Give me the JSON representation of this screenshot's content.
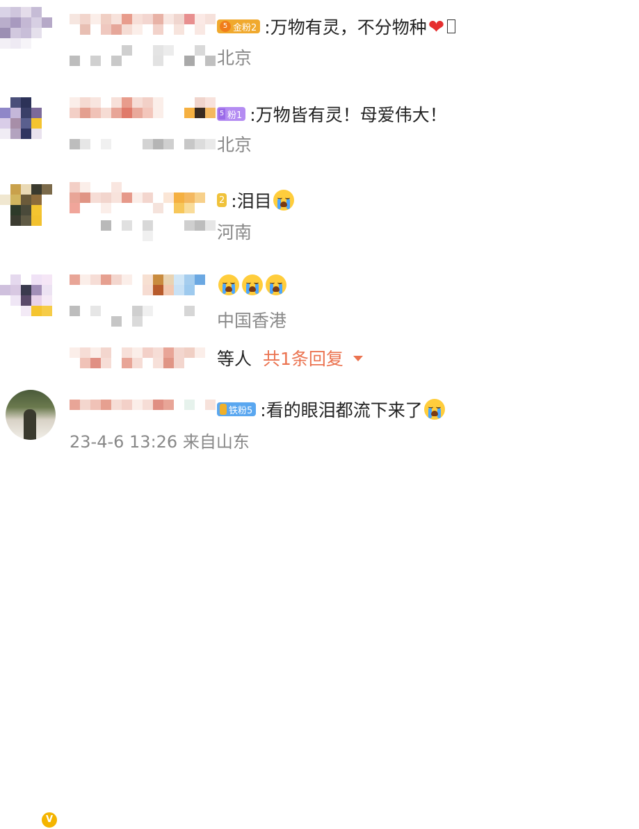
{
  "comments": [
    {
      "badge": {
        "text": "金粉2",
        "color": "#f0a92e",
        "medal_color": "#f07d1a",
        "medal_text": "5"
      },
      "text": ":万物有灵，不分物种",
      "location": "北京"
    },
    {
      "badge": {
        "text": "粉1",
        "color": "#b48cf2",
        "medal_color": "#9a6ae8",
        "medal_text": "5"
      },
      "text": ":万物皆有灵！母爱伟大！",
      "location": "北京"
    },
    {
      "badge": {
        "text": "2",
        "color": "#f0c23a",
        "medal_color": "#f0c23a",
        "medal_text": ""
      },
      "text": ":泪目",
      "location": "河南"
    },
    {
      "text": "",
      "location": "中国香港"
    },
    {
      "badge": {
        "text": "铁粉5",
        "color": "#5aa7f0",
        "medal_color": "#f0b02a",
        "medal_text": ""
      },
      "text": ":看的眼泪都流下来了"
    }
  ],
  "replies": {
    "prefix": "等人",
    "link": "共1条回复"
  },
  "last_meta": "23-4-6 13:26 来自山东",
  "verified_mark": "V",
  "colors": {
    "accent": "#eb7350",
    "muted": "#888888",
    "heart": "#e62e2e"
  }
}
